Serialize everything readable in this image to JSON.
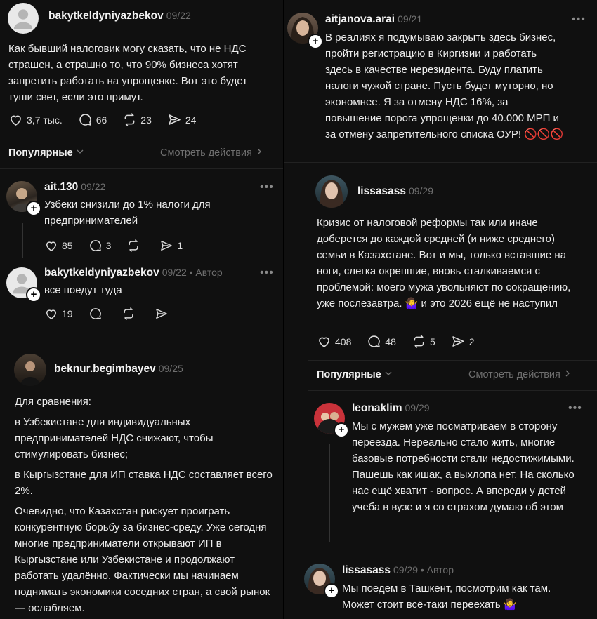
{
  "left": {
    "post": {
      "username": "bakytkeldyniyazbekov",
      "date": "09/22",
      "text": "Как бывший налоговик могу сказать, что не НДС страшен, а страшно то, что 90% бизнеса хотят запретить работать на упрощенке. Вот это будет туши свет, если это примут.",
      "likes": "3,7 тыс.",
      "comments": "66",
      "reposts": "23",
      "shares": "24"
    },
    "sort": {
      "label": "Популярные",
      "activity": "Смотреть действия"
    },
    "reply1": {
      "username": "ait.130",
      "date": "09/22",
      "text": "Узбеки снизили до 1% налоги для предпринимателей",
      "likes": "85",
      "comments": "3",
      "shares": "1"
    },
    "reply2": {
      "username": "bakytkeldyniyazbekov",
      "date": "09/22 • Автор",
      "text": "все поедут туда",
      "likes": "19"
    },
    "post2": {
      "username": "beknur.begimbayev",
      "date": "09/25",
      "paragraphs": [
        "Для сравнения:",
        "в Узбекистане для индивидуальных предпринимателей НДС снижают, чтобы стимулировать бизнес;",
        "в Кыргызстане для ИП ставка НДС составляет всего 2%.",
        "Очевидно, что Казахстан рискует проиграть конкурентную борьбу за бизнес-среду. Уже сегодня многие предприниматели открывают ИП в Кыргызстане или Узбекистане и продолжают работать удалённо. Фактически мы начинаем поднимать экономики соседних стран, а свой рынок — ослабляем."
      ]
    }
  },
  "right": {
    "post1": {
      "username": "aitjanova.arai",
      "date": "09/21",
      "text": "В реалиях я подумываю закрыть здесь бизнес, пройти регистрацию в Киргизии и работать здесь в качестве нерезидента. Буду платить налоги чужой стране. Пусть будет муторно, но экономнее. Я за отмену НДС 16%, за повышение порога упрощенки до 40.000 МРП и за отмену запретительного списка ОУР! 🚫🚫🚫"
    },
    "post2": {
      "username": "lissasass",
      "date": "09/29",
      "text": "Кризис от налоговой реформы так или иначе доберется до каждой средней (и ниже среднего) семьи в Казахстане. Вот и мы, только вставшие на ноги, слегка окрепшие, вновь сталкиваемся с проблемой: моего мужа увольняют по сокращению, уже послезавтра. 🤷‍♀️ и это 2026 ещё не наступил",
      "likes": "408",
      "comments": "48",
      "reposts": "5",
      "shares": "2"
    },
    "sort": {
      "label": "Популярные",
      "activity": "Смотреть действия"
    },
    "reply1": {
      "username": "leonaklim",
      "date": "09/29",
      "text": "Мы с мужем уже посматриваем в сторону переезда. Нереально стало жить, многие базовые потребности стали недостижимыми. Пашешь как ишак, а выхлопа нет. На сколько нас ещё хватит - вопрос. А впереди у детей учеба в вузе и я со страхом думаю об этом"
    },
    "reply2": {
      "username": "lissasass",
      "date": "09/29 • Автор",
      "text": "Мы поедем в Ташкент, посмотрим как там. Может стоит всё-таки переехать 🤷‍♀️"
    }
  },
  "colors": {
    "background": "#101010",
    "text": "#ececec",
    "muted": "#6e6e6e"
  }
}
